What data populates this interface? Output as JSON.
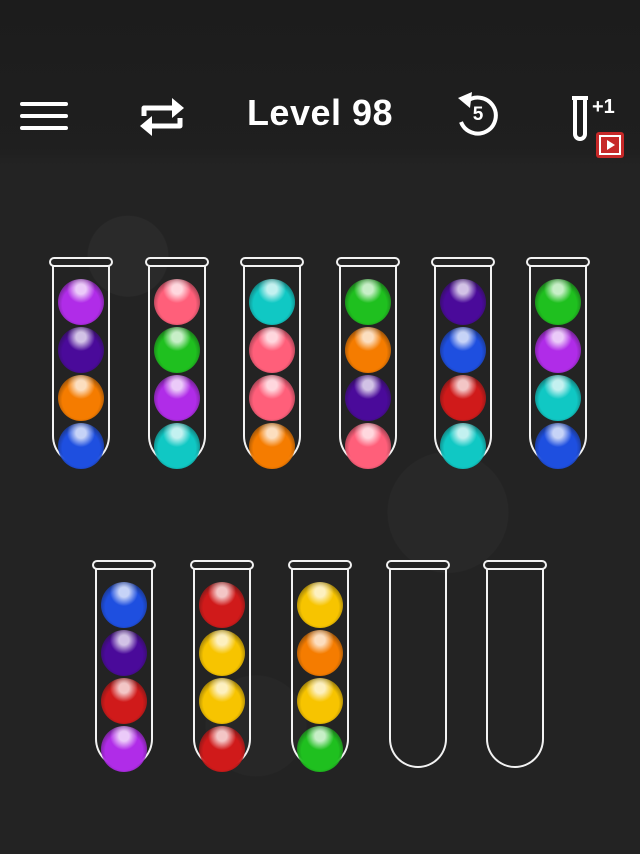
{
  "header": {
    "title": "Level 98",
    "undo_count": "5",
    "add_tube_label": "+1"
  },
  "colors": {
    "purple": "#b02ce8",
    "indigo": "#4a0a9a",
    "orange": "#f57c00",
    "blue": "#1e4fe0",
    "pink": "#ff5f7a",
    "green": "#1fc01f",
    "cyan": "#10c8c4",
    "red": "#d01a1a",
    "yellow": "#f7c400"
  },
  "tubes": [
    {
      "balls": [
        "purple",
        "indigo",
        "orange",
        "blue"
      ]
    },
    {
      "balls": [
        "pink",
        "green",
        "purple",
        "cyan"
      ]
    },
    {
      "balls": [
        "cyan",
        "pink",
        "pink",
        "orange"
      ]
    },
    {
      "balls": [
        "green",
        "orange",
        "indigo",
        "pink"
      ]
    },
    {
      "balls": [
        "indigo",
        "blue",
        "red",
        "cyan"
      ]
    },
    {
      "balls": [
        "green",
        "purple",
        "cyan",
        "blue"
      ]
    },
    {
      "balls": [
        "blue",
        "indigo",
        "red",
        "purple"
      ]
    },
    {
      "balls": [
        "red",
        "yellow",
        "yellow",
        "red"
      ]
    },
    {
      "balls": [
        "yellow",
        "orange",
        "yellow",
        "green"
      ]
    },
    {
      "balls": []
    },
    {
      "balls": []
    }
  ]
}
